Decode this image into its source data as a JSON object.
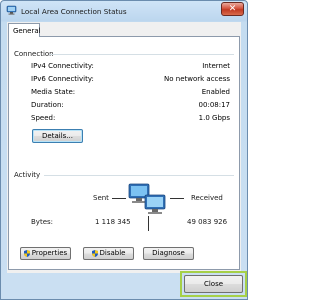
{
  "window": {
    "title": "Local Area Connection Status",
    "close_glyph": "✕"
  },
  "tabs": [
    {
      "label": "General"
    }
  ],
  "connection": {
    "heading": "Connection",
    "rows": [
      {
        "label": "IPv4 Connectivity:",
        "value": "Internet"
      },
      {
        "label": "IPv6 Connectivity:",
        "value": "No network access"
      },
      {
        "label": "Media State:",
        "value": "Enabled"
      },
      {
        "label": "Duration:",
        "value": "00:08:17"
      },
      {
        "label": "Speed:",
        "value": "1.0 Gbps"
      }
    ],
    "details_button": "Details..."
  },
  "activity": {
    "heading": "Activity",
    "sent_label": "Sent",
    "received_label": "Received",
    "bytes_label": "Bytes:",
    "bytes_sent": "1 118 345",
    "bytes_received": "49 083 926"
  },
  "buttons": {
    "properties": "Properties",
    "disable": "Disable",
    "diagnose": "Diagnose",
    "close": "Close"
  },
  "icons": {
    "app": "network-icon",
    "activity": "network-computers-icon",
    "shield": "uac-shield-icon"
  }
}
